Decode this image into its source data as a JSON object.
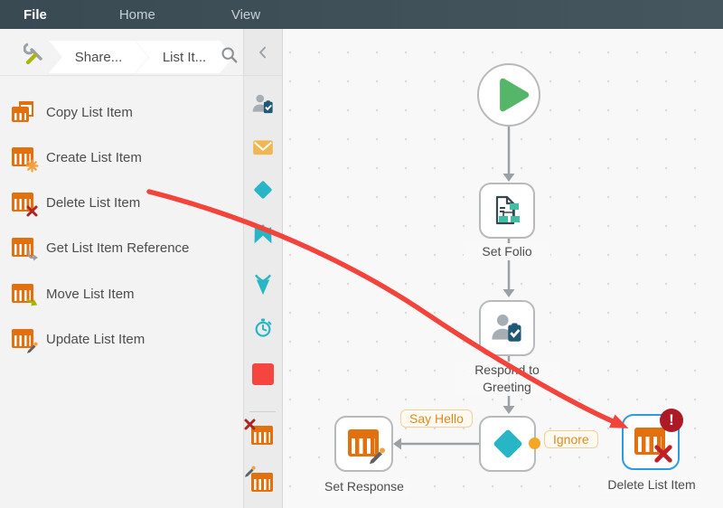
{
  "menubar": {
    "items": [
      "File",
      "Home",
      "View"
    ]
  },
  "breadcrumb": {
    "segments": [
      "Share...",
      "List It..."
    ],
    "icons": [
      "tools-icon",
      "search-icon"
    ]
  },
  "sidebar": {
    "items": [
      {
        "label": "Copy List Item",
        "icon": "copy-list-item-icon"
      },
      {
        "label": "Create List Item",
        "icon": "create-list-item-icon"
      },
      {
        "label": "Delete List Item",
        "icon": "delete-list-item-icon"
      },
      {
        "label": "Get List Item Reference",
        "icon": "get-list-item-reference-icon"
      },
      {
        "label": "Move List Item",
        "icon": "move-list-item-icon"
      },
      {
        "label": "Update List Item",
        "icon": "update-list-item-icon"
      }
    ]
  },
  "toolbar": {
    "collapse_icon": "chevron-left-icon",
    "icons": [
      "user-task-icon",
      "email-icon",
      "decision-icon",
      "split-icon",
      "merge-icon",
      "timer-icon",
      "end-icon",
      "delete-list-item-icon",
      "update-list-item-icon"
    ]
  },
  "canvas": {
    "start_node": "start-play-icon",
    "set_folio_label": "Set Folio",
    "respond_label_line1": "Respond to",
    "respond_label_line2": "Greeting",
    "set_response_label": "Set Response",
    "delete_node_label": "Delete List Item",
    "say_hello_label": "Say Hello",
    "ignore_label": "Ignore",
    "error_badge": "!"
  },
  "colors": {
    "topbar": "#3d4e58",
    "accent_orange": "#e2700f",
    "teal": "#28b5c6",
    "teal_green": "#41bda5",
    "green": "#55b669",
    "annotation_red": "#f4433a",
    "selection_blue": "#2d9be2",
    "error_red": "#ad1a26",
    "badge_orange_text": "#dd8a1d"
  }
}
